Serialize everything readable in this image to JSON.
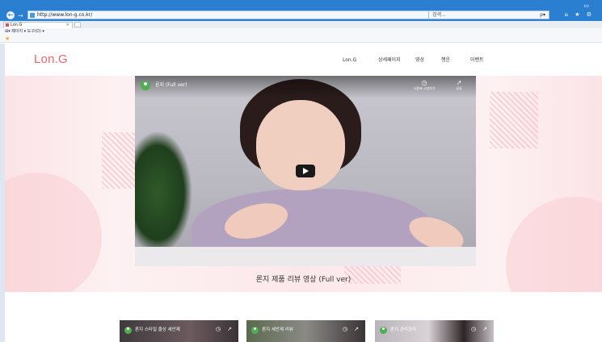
{
  "browser": {
    "url": "http://www.lon-g.co.kr/",
    "refresh_icon": "v ↻",
    "search_placeholder": "검색...",
    "search_icon": "ρ▾",
    "window_controls": "▭",
    "tool_icons": "⌂ ★ ⚙",
    "back_icon": "←",
    "forward_icon": "→",
    "tab_title": "Lon.G",
    "tab_close": "×",
    "menu_text": "⊞▾ 페이지 ▾  도구(O) ▾",
    "fav_icon": "★"
  },
  "site": {
    "logo": "Lon.G",
    "nav": [
      "Lon.G",
      "상세페이지",
      "영상",
      "행운",
      "이벤트"
    ]
  },
  "hero": {
    "video_title": "론지 (Full ver)",
    "watch_later_label": "나중에 시청하기",
    "share_label": "공유",
    "watch_later_icon": "◷",
    "share_icon": "↗",
    "caption": "론지 제품 리뷰 영상 (Full ver)"
  },
  "thumbnails": [
    {
      "title": "론지 스타일 줄상 세안제",
      "clock_icon": "◷",
      "share_icon": "↗"
    },
    {
      "title": "론지 세안제 리뷰",
      "clock_icon": "◷",
      "share_icon": "↗"
    },
    {
      "title": "론지 관리관리",
      "clock_icon": "◷",
      "share_icon": "↗"
    }
  ],
  "colors": {
    "brand": "#e8676d",
    "titlebar": "#2b7fd1",
    "hero_pink": "#fbe3e6"
  }
}
